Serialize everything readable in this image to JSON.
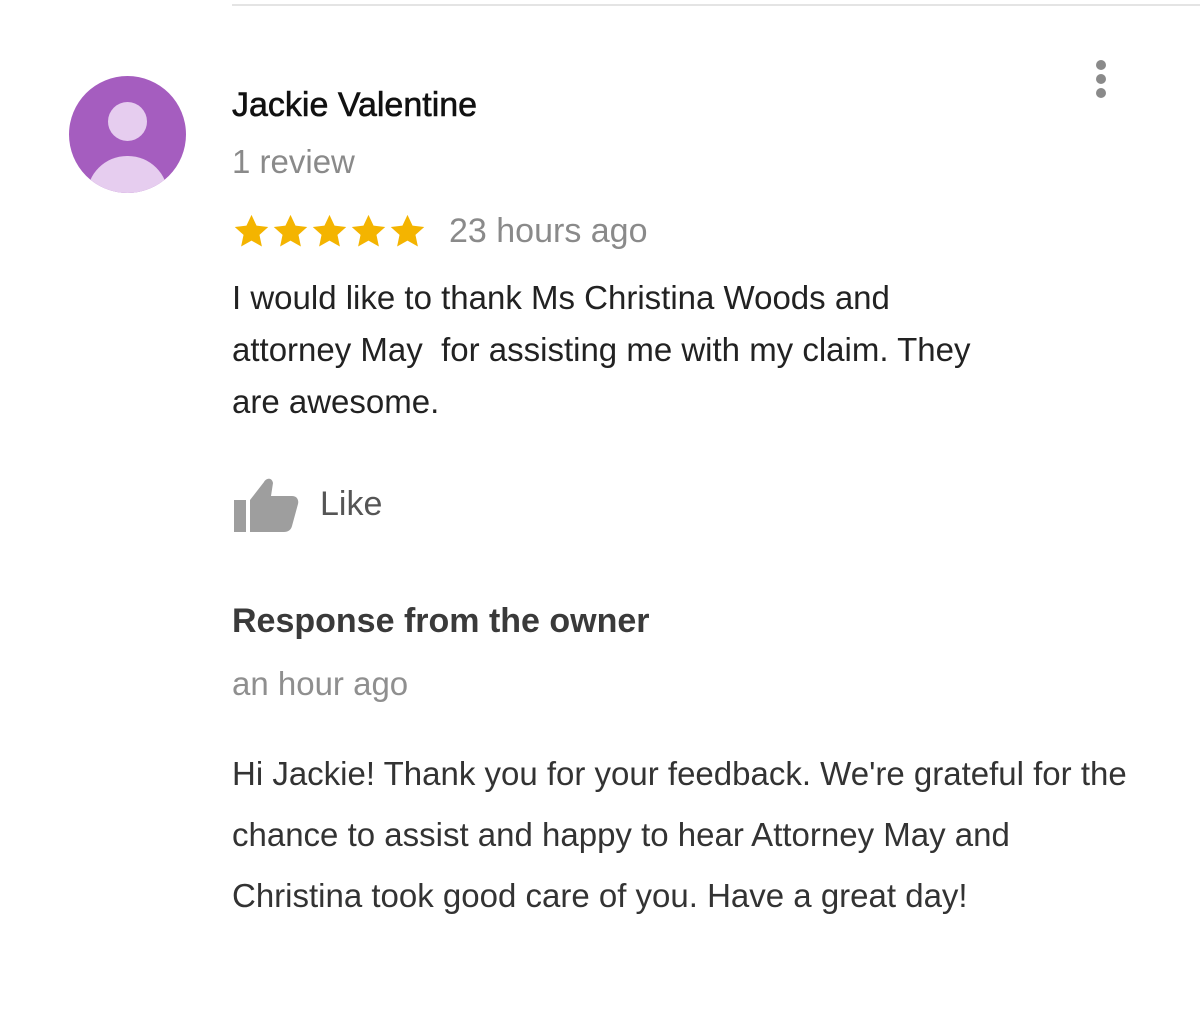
{
  "review": {
    "reviewer_name": "Jackie Valentine",
    "review_count": "1 review",
    "rating": 5,
    "rating_max": 5,
    "time": "23 hours ago",
    "text": "I would like to thank Ms Christina Woods and\nattorney May  for assisting me with my claim. They\nare awesome.",
    "avatar_icon": "person-icon",
    "avatar_color": "#a55dbf",
    "star_color": "#f4b400",
    "menu_icon": "more-vert-icon"
  },
  "actions": {
    "like_label": "Like",
    "like_icon": "thumbs-up-icon"
  },
  "owner_response": {
    "heading": "Response from the owner",
    "time": "an hour ago",
    "text": "Hi Jackie! Thank you for your feedback. We're grateful for the chance to assist and happy to hear Attorney May and Christina took good care of you. Have a great day!"
  }
}
